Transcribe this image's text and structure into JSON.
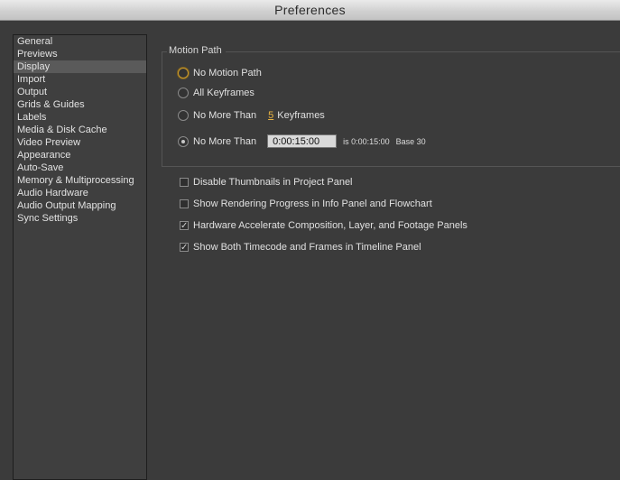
{
  "window": {
    "title": "Preferences"
  },
  "sidebar": {
    "items": [
      {
        "label": "General"
      },
      {
        "label": "Previews"
      },
      {
        "label": "Display",
        "selected": true
      },
      {
        "label": "Import"
      },
      {
        "label": "Output"
      },
      {
        "label": "Grids & Guides"
      },
      {
        "label": "Labels"
      },
      {
        "label": "Media & Disk Cache"
      },
      {
        "label": "Video Preview"
      },
      {
        "label": "Appearance"
      },
      {
        "label": "Auto-Save"
      },
      {
        "label": "Memory & Multiprocessing"
      },
      {
        "label": "Audio Hardware"
      },
      {
        "label": "Audio Output Mapping"
      },
      {
        "label": "Sync Settings"
      }
    ]
  },
  "motion_path": {
    "group_title": "Motion Path",
    "options": {
      "no_motion_path": "No Motion Path",
      "all_keyframes": "All Keyframes",
      "no_more_than_1": "No More Than",
      "keyframes_count": "5",
      "keyframes_label": "Keyframes",
      "no_more_than_2": "No More Than",
      "time_value": "0:00:15:00",
      "time_note": "is 0:00:15:00",
      "base_note": "Base 30"
    },
    "selected": "no_more_than_time"
  },
  "checkboxes": [
    {
      "label": "Disable Thumbnails in Project Panel",
      "checked": false
    },
    {
      "label": "Show Rendering Progress in Info Panel and Flowchart",
      "checked": false
    },
    {
      "label": "Hardware Accelerate Composition, Layer, and Footage Panels",
      "checked": true
    },
    {
      "label": "Show Both Timecode and Frames in Timeline Panel",
      "checked": true
    }
  ],
  "colors": {
    "accent": "#e8b341",
    "focus_ring": "#c99a2e",
    "panel_bg": "#3b3b3b"
  }
}
